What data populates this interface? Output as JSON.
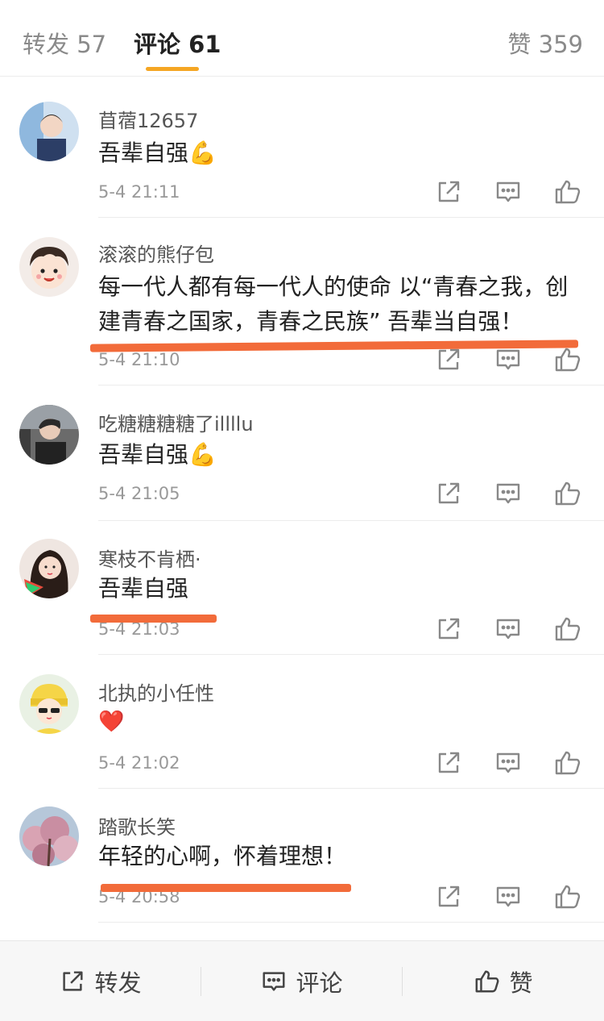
{
  "tabs": {
    "repost": "转发 57",
    "comments": "评论 61",
    "likes": "赞 359"
  },
  "comments": [
    {
      "user": "苜蓿12657",
      "text": "吾辈自强💪",
      "time": "5-4 21:11"
    },
    {
      "user": "滚滚的熊仔包",
      "text": "每一代人都有每一代人的使命 以“青春之我，创建青春之国家，青春之民族” 吾辈当自强！",
      "time": "5-4 21:10"
    },
    {
      "user": "吃糖糖糖糖了illllu",
      "text": "吾辈自强💪",
      "time": "5-4 21:05"
    },
    {
      "user": "寒枝不肯栖·",
      "text": "吾辈自强",
      "time": "5-4 21:03"
    },
    {
      "user": "北执的小任性",
      "text": "❤️",
      "time": "5-4 21:02"
    },
    {
      "user": "踏歌长笑",
      "text": "年轻的心啊，怀着理想！",
      "time": "5-4 20:58"
    }
  ],
  "bottom_bar": {
    "repost": "转发",
    "comment": "评论",
    "like": "赞"
  },
  "colors": {
    "tab_accent": "#f5a623",
    "annotation_red": "#f26b3a"
  },
  "icons": [
    "share-icon",
    "reply-icon",
    "like-icon"
  ]
}
